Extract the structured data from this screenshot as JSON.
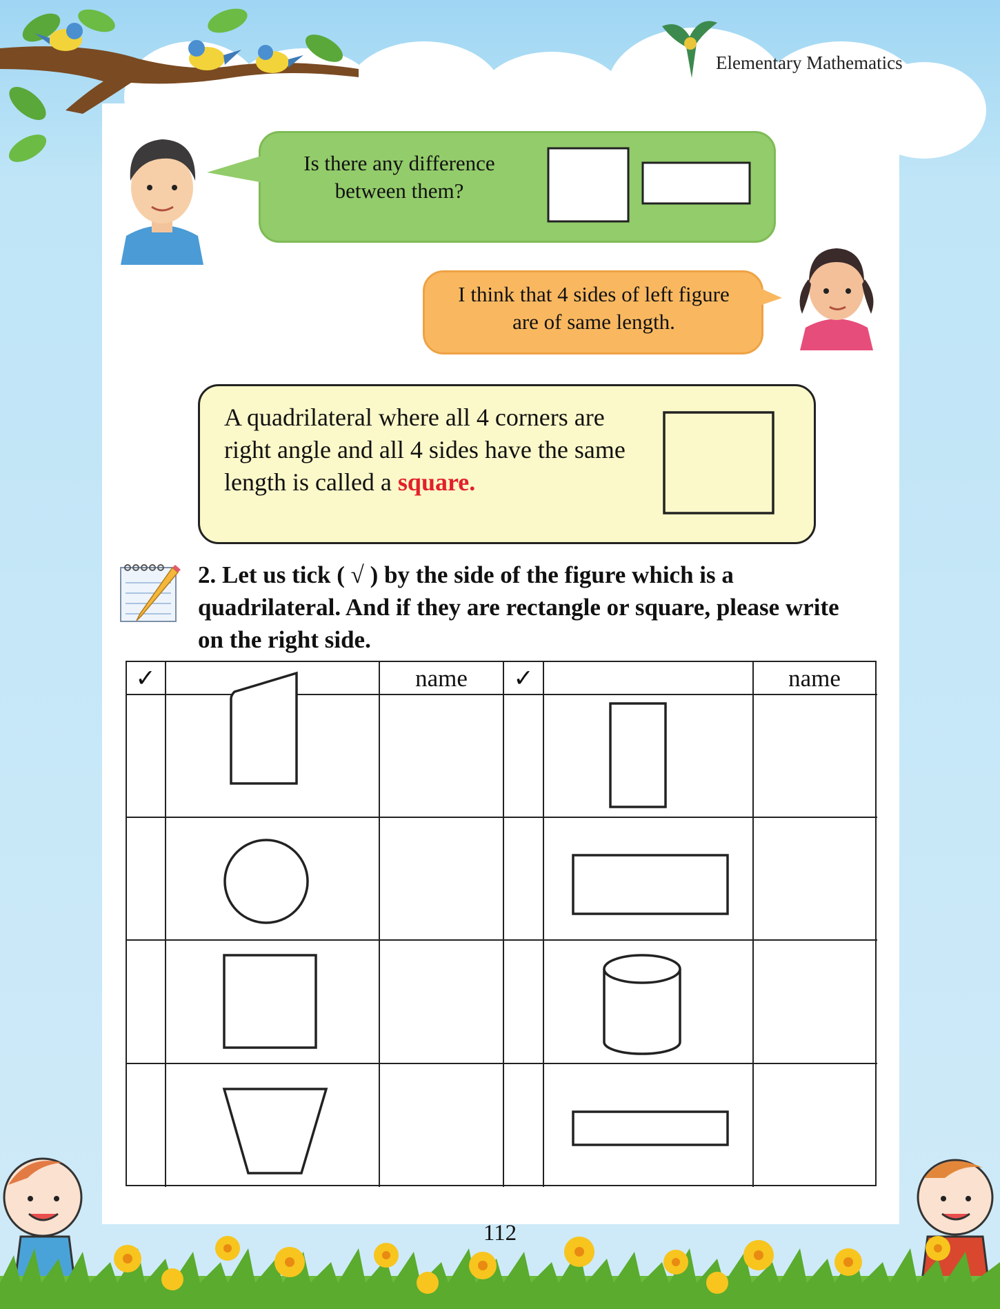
{
  "header": {
    "title": "Elementary Mathematics"
  },
  "dialogue": {
    "boy_question": [
      "Is there any difference",
      "between them?"
    ],
    "girl_answer": [
      "I think that 4 sides of left figure",
      "are  of  same length."
    ]
  },
  "definition": {
    "text_before": "A quadrilateral where all 4 corners are right angle and all 4 sides have the same length is called a ",
    "highlight": "square.",
    "highlight_color": "#e3202a"
  },
  "exercise": {
    "number": "2.",
    "instruction": "Let us  tick ( √ ) by the side of the figure which is a quadrilateral. And if they are rectangle or square, please write on the  right  side.",
    "columns": {
      "tick_left": "✓",
      "name_left": "name",
      "tick_right": "✓",
      "name_right": "name"
    },
    "rows": [
      {
        "left_shape": "trapezium-right-angle",
        "right_shape": "tall-rectangle"
      },
      {
        "left_shape": "circle",
        "right_shape": "wide-rectangle"
      },
      {
        "left_shape": "square",
        "right_shape": "cylinder"
      },
      {
        "left_shape": "inverted-trapezoid",
        "right_shape": "thin-rectangle"
      }
    ]
  },
  "footer": {
    "page_number": "112"
  },
  "colors": {
    "sky": "#9fd6f3",
    "green_bubble": "#93cc6b",
    "orange_bubble": "#f9b860",
    "definition_bg": "#fbf8c9"
  }
}
